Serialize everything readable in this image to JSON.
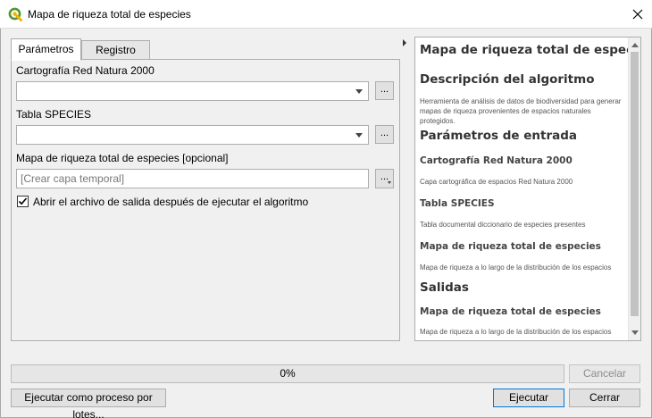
{
  "window": {
    "title": "Mapa de riqueza total de especies"
  },
  "tabs": [
    {
      "label": "Parámetros",
      "active": true
    },
    {
      "label": "Registro",
      "active": false
    }
  ],
  "params": {
    "field1_label": "Cartografía Red Natura 2000",
    "field1_value": "",
    "field2_label": "Tabla SPECIES",
    "field2_value": "",
    "field3_label": "Mapa de riqueza total de especies [opcional]",
    "field3_placeholder": "[Crear capa temporal]",
    "browse_label": "...",
    "checkbox_label": "Abrir el archivo de salida después de ejecutar el algoritmo",
    "checkbox_checked": true
  },
  "help": {
    "title": "Mapa de riqueza total de especies",
    "desc_heading": "Descripción del algoritmo",
    "desc_text": "Herramienta de análisis de datos de biodiversidad para generar mapas de riqueza provenientes de espacios naturales protegidos.",
    "inputs_heading": "Parámetros de entrada",
    "in1_name": "Cartografía Red Natura 2000",
    "in1_desc": "Capa cartográfica de espacios Red Natura 2000",
    "in2_name": "Tabla SPECIES",
    "in2_desc": "Tabla documental diccionario de especies presentes",
    "in3_name": "Mapa de riqueza total de especies",
    "in3_desc": "Mapa de riqueza a lo largo de la distribución de los espacios",
    "outputs_heading": "Salidas",
    "out1_name": "Mapa de riqueza total de especies",
    "out1_desc": "Mapa de riqueza a lo largo de la distribución de los espacios"
  },
  "progress": {
    "value": 0,
    "text": "0%"
  },
  "buttons": {
    "cancel": "Cancelar",
    "batch": "Ejecutar como proceso por lotes...",
    "run": "Ejecutar",
    "close": "Cerrar"
  },
  "colors": {
    "qgis_green": "#589632",
    "progress_fill": "#06b025",
    "default_button_border": "#0078d7"
  }
}
